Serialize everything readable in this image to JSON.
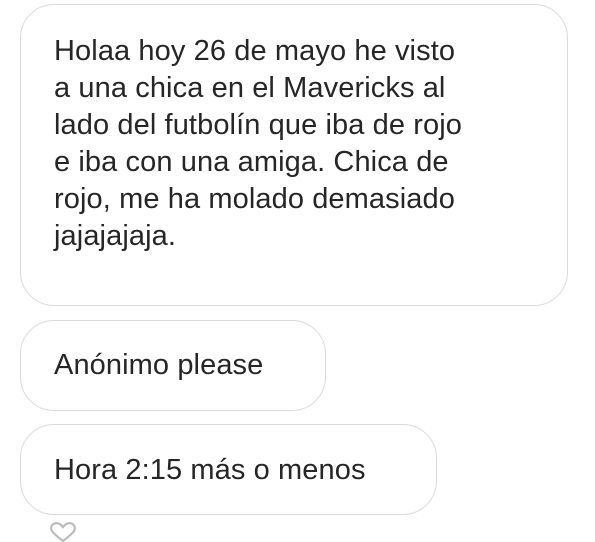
{
  "messages": [
    {
      "lines": [
        "Holaa hoy 26 de mayo he visto",
        "a una chica en el Mavericks al",
        "lado del futbolín que iba de rojo",
        "e iba con una amiga. Chica de",
        "rojo, me ha molado demasiado",
        "jajajajaja."
      ]
    },
    {
      "text": "Anónimo please"
    },
    {
      "text": "Hora 2:15 más o menos"
    }
  ],
  "icons": {
    "reaction": "heart-icon"
  },
  "colors": {
    "bubble_border": "#dbdbdb",
    "text": "#262626",
    "background": "#ffffff",
    "heart": "#bcbcbc"
  }
}
